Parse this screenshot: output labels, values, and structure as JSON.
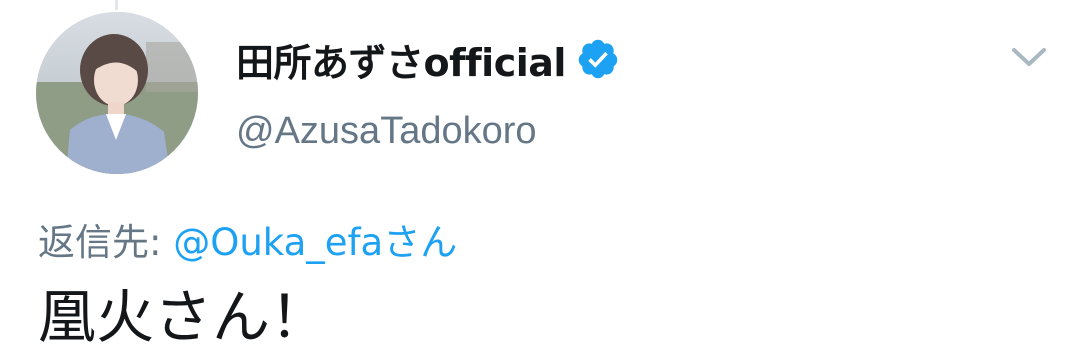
{
  "user": {
    "display_name": "田所あずさofficial",
    "handle": "@AzusaTadokoro",
    "verified": true,
    "avatar_icon": "profile-photo"
  },
  "reply": {
    "prefix": "返信先: ",
    "target": "@Ouka_efaさん"
  },
  "tweet": {
    "text": "凰火さん！"
  },
  "icons": {
    "verified": "verified-badge-icon",
    "menu": "chevron-down-icon"
  },
  "colors": {
    "accent": "#1da1f2",
    "secondary_text": "#657786",
    "primary_text": "#14171a",
    "chevron": "#aab8c2"
  }
}
